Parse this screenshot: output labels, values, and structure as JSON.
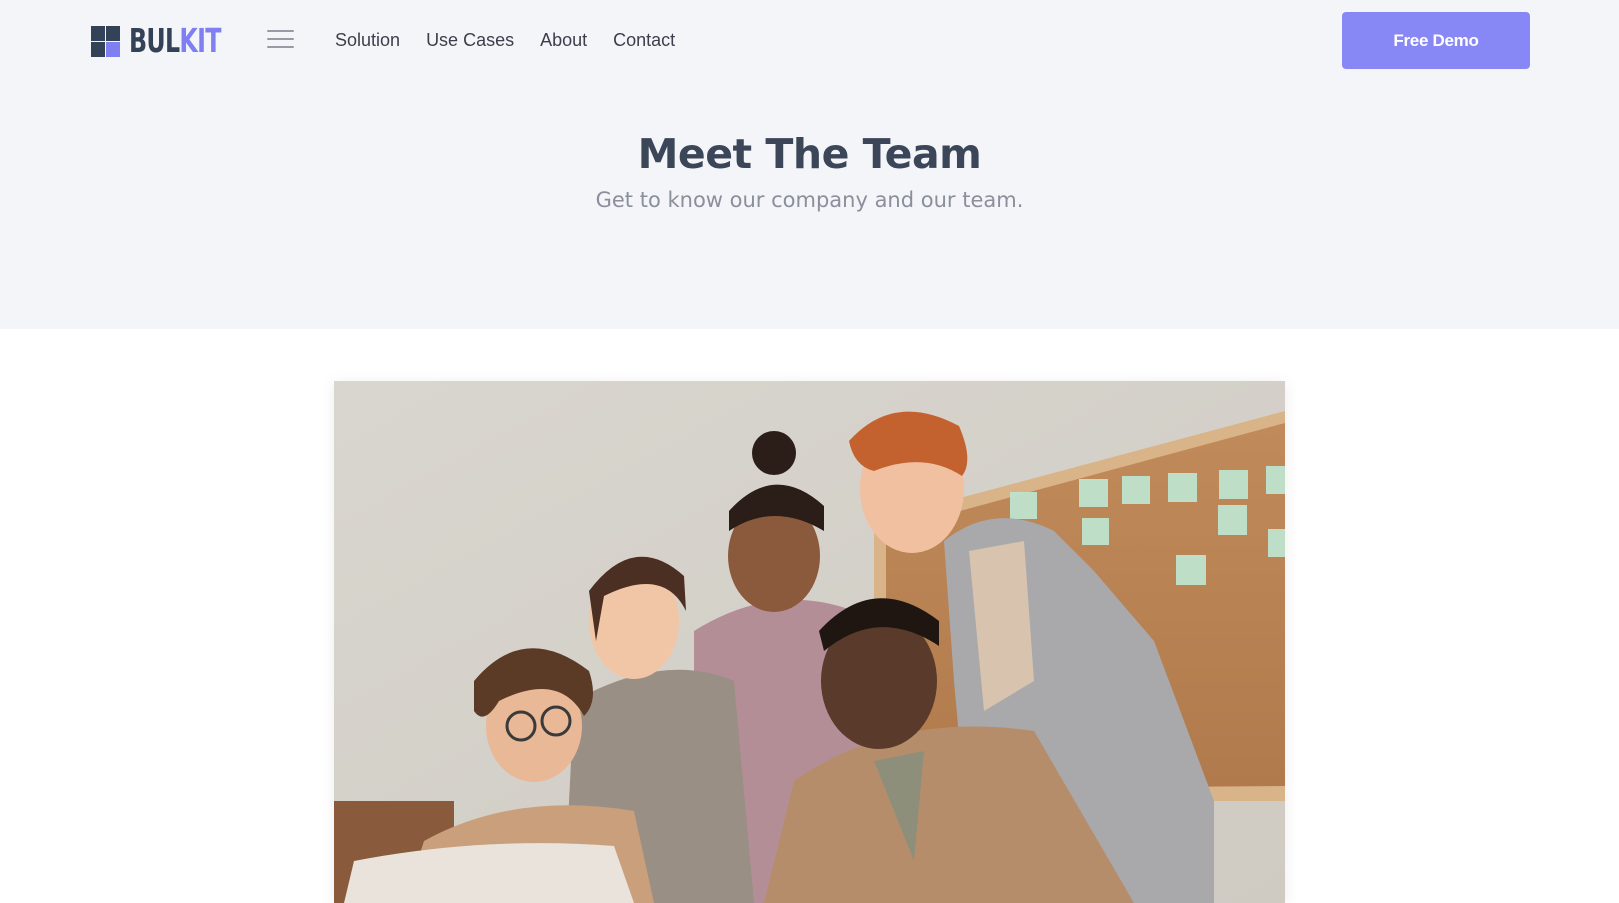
{
  "header": {
    "logo": {
      "part1": "BUL",
      "part2": "KIT"
    },
    "nav": [
      {
        "label": "Solution"
      },
      {
        "label": "Use Cases"
      },
      {
        "label": "About"
      },
      {
        "label": "Contact"
      }
    ],
    "cta_label": "Free Demo",
    "icons": {
      "menu": "hamburger-menu-icon"
    }
  },
  "hero": {
    "title": "Meet The Team",
    "subtitle": "Get to know our company and our team."
  },
  "colors": {
    "accent": "#8787f5",
    "brand_dark": "#344258",
    "brand_light": "#7f7ff2",
    "hero_bg": "#f4f5f9"
  }
}
